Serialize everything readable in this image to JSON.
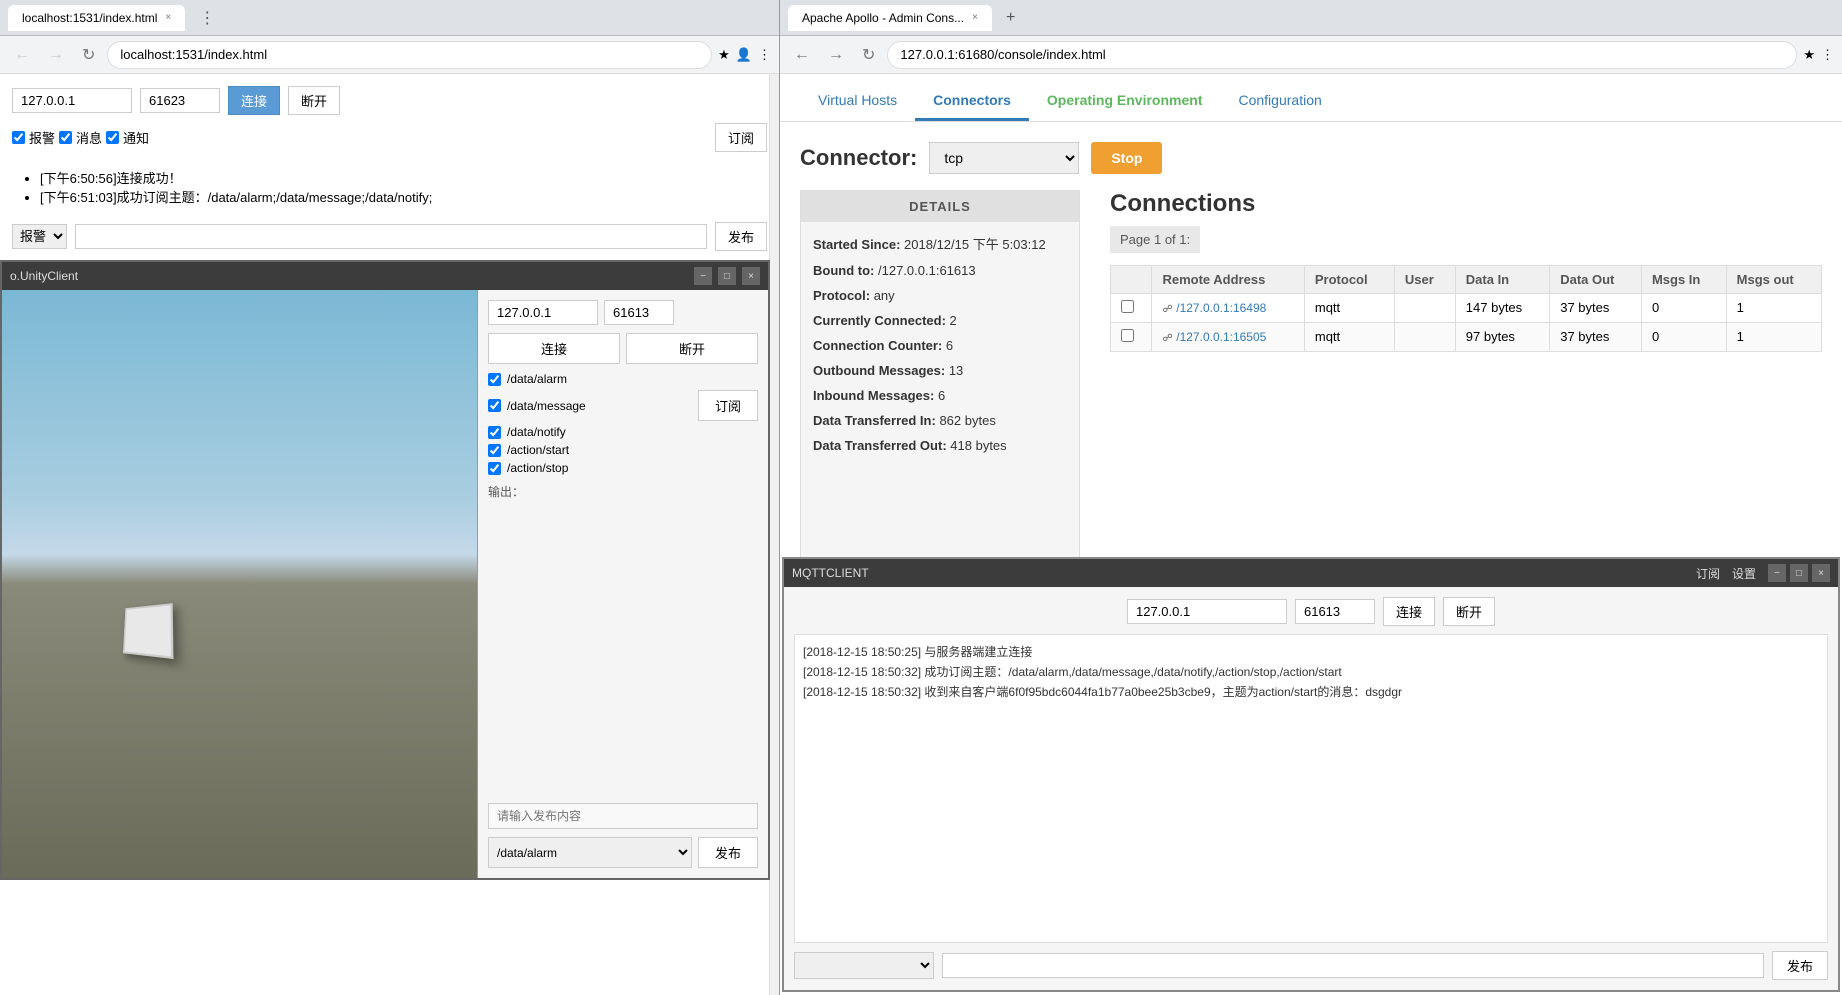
{
  "left_browser": {
    "tab_title": "localhost:1531/index.html",
    "url": "localhost:1531/index.html",
    "ip_field": "127.0.0.1",
    "port_field": "61623",
    "connect_btn": "连接",
    "disconnect_btn": "断开",
    "subscribe_btn": "订阅",
    "alarm_label": "报警",
    "message_label": "消息",
    "notify_label": "通知",
    "logs": [
      "[下午6:50:56]连接成功！",
      "[下午6:51:03]成功订阅主题：/data/alarm;/data/message;/data/notify;"
    ],
    "publish_dropdown_label": "报警",
    "publish_btn": "发布"
  },
  "unity_window": {
    "title": "o.UnityClient",
    "ip_field": "127.0.0.1",
    "port_field": "61613",
    "connect_btn": "连接",
    "disconnect_btn": "断开",
    "topics": [
      "/data/alarm",
      "/data/message",
      "/data/notify",
      "/action/start",
      "/action/stop"
    ],
    "subscribe_btn": "订阅",
    "output_label": "输出：",
    "publish_placeholder": "请输入发布内容",
    "publish_topic": "/data/alarm",
    "publish_btn": "发布"
  },
  "right_browser": {
    "tab_title": "Apache Apollo - Admin Cons...",
    "url": "127.0.0.1:61680/console/index.html",
    "nav": {
      "virtual_hosts": "Virtual Hosts",
      "connectors": "Connectors",
      "operating_env": "Operating Environment",
      "configuration": "Configuration"
    },
    "connector_label": "Connector:",
    "connector_value": "tcp",
    "stop_btn": "Stop",
    "details": {
      "header": "DETAILS",
      "started_since_label": "Started Since:",
      "started_since_value": "2018/12/15 下午 5:03:12",
      "bound_to_label": "Bound to:",
      "bound_to_value": "/127.0.0.1:61613",
      "protocol_label": "Protocol:",
      "protocol_value": "any",
      "currently_connected_label": "Currently Connected:",
      "currently_connected_value": "2",
      "connection_counter_label": "Connection Counter:",
      "connection_counter_value": "6",
      "outbound_messages_label": "Outbound Messages:",
      "outbound_messages_value": "13",
      "inbound_messages_label": "Inbound Messages:",
      "inbound_messages_value": "6",
      "data_in_label": "Data Transferred In:",
      "data_in_value": "862 bytes",
      "data_out_label": "Data Transferred Out:",
      "data_out_value": "418 bytes"
    },
    "connections": {
      "title": "Connections",
      "page_info": "Page 1 of 1:",
      "columns": [
        "",
        "Remote Address",
        "Protocol",
        "User",
        "Data In",
        "Data Out",
        "Msgs In",
        "Msgs out"
      ],
      "rows": [
        {
          "address": "/127.0.0.1:16498",
          "protocol": "mqtt",
          "user": "",
          "data_in": "147 bytes",
          "data_out": "37 bytes",
          "msgs_in": "0",
          "msgs_out": "1"
        },
        {
          "address": "/127.0.0.1:16505",
          "protocol": "mqtt",
          "user": "",
          "data_in": "97 bytes",
          "data_out": "37 bytes",
          "msgs_in": "0",
          "msgs_out": "1"
        }
      ]
    }
  },
  "mqtt_window": {
    "title": "MQTTCLIENT",
    "subscribe_btn": "订阅",
    "settings_btn": "设置",
    "ip_field": "127.0.0.1",
    "port_field": "61613",
    "connect_btn": "连接",
    "disconnect_btn": "断开",
    "logs": [
      "[2018-12-15 18:50:25] 与服务器端建立连接",
      "[2018-12-15 18:50:32] 成功订阅主题：/data/alarm,/data/message,/data/notify,/action/stop,/action/start",
      "[2018-12-15 18:50:32] 收到来自客户端6f0f95bdc6044fa1b77a0bee25b3cbe9，主题为action/start的消息：dsgdgr"
    ],
    "publish_topic": "",
    "publish_placeholder": "",
    "publish_btn": "发布"
  },
  "icons": {
    "back": "←",
    "forward": "→",
    "reload": "↻",
    "close": "×",
    "minimize": "−",
    "maximize": "□",
    "checkbox_checked": "✓",
    "star": "★",
    "account": "👤",
    "more": "⋮",
    "expand": "▾"
  }
}
